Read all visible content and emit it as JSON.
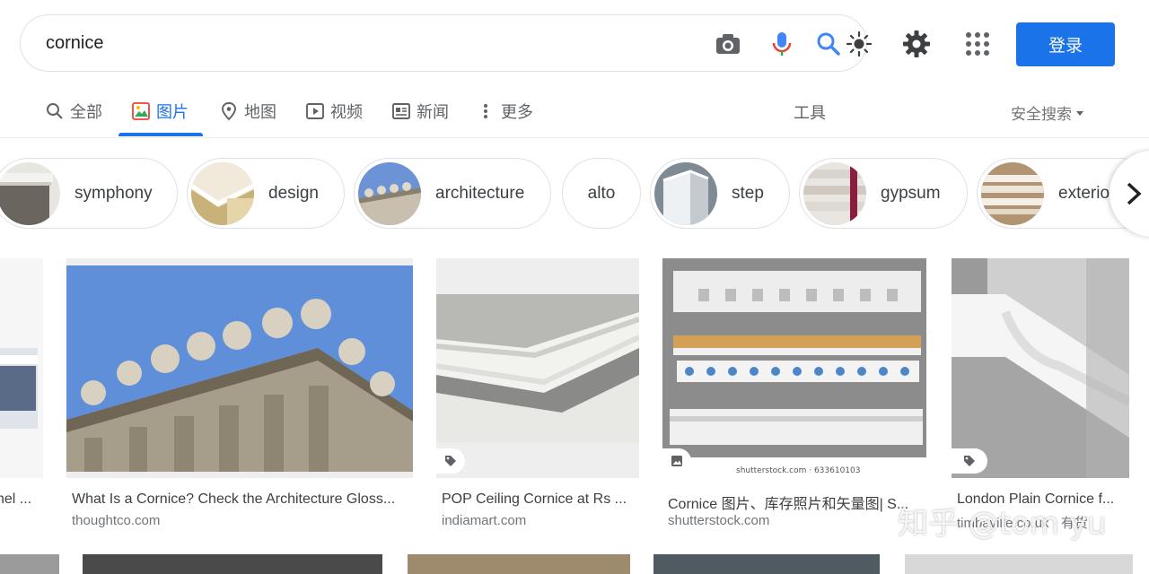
{
  "search": {
    "query": "cornice"
  },
  "header": {
    "login_label": "登录"
  },
  "tabs": [
    {
      "label": "全部",
      "icon": "search-icon"
    },
    {
      "label": "图片",
      "icon": "image-icon",
      "active": true
    },
    {
      "label": "地图",
      "icon": "map-pin-icon"
    },
    {
      "label": "视频",
      "icon": "video-icon"
    },
    {
      "label": "新闻",
      "icon": "news-icon"
    },
    {
      "label": "更多",
      "icon": "more-vert-icon"
    }
  ],
  "tools_label": "工具",
  "safe_search_label": "安全搜索",
  "chips": [
    {
      "label": "symphony"
    },
    {
      "label": "design"
    },
    {
      "label": "architecture"
    },
    {
      "label": "alto"
    },
    {
      "label": "step"
    },
    {
      "label": "gypsum"
    },
    {
      "label": "exterio"
    }
  ],
  "results": [
    {
      "title": "nel ...",
      "source": ""
    },
    {
      "title": "What Is a Cornice? Check the Architecture Gloss...",
      "source": "thoughtco.com"
    },
    {
      "title": "POP Ceiling Cornice at Rs ...",
      "source": "indiamart.com"
    },
    {
      "title": "Cornice 图片、库存照片和矢量图| S...",
      "source": "shutterstock.com",
      "image_caption": "shutterstock.com · 633610103"
    },
    {
      "title": "London Plain Cornice f...",
      "source": "timbaville.co.uk · 有货"
    }
  ],
  "watermark": "知乎 @tom yu",
  "colors": {
    "accent": "#1a73e8",
    "text": "#202124",
    "muted": "#5f6368"
  }
}
